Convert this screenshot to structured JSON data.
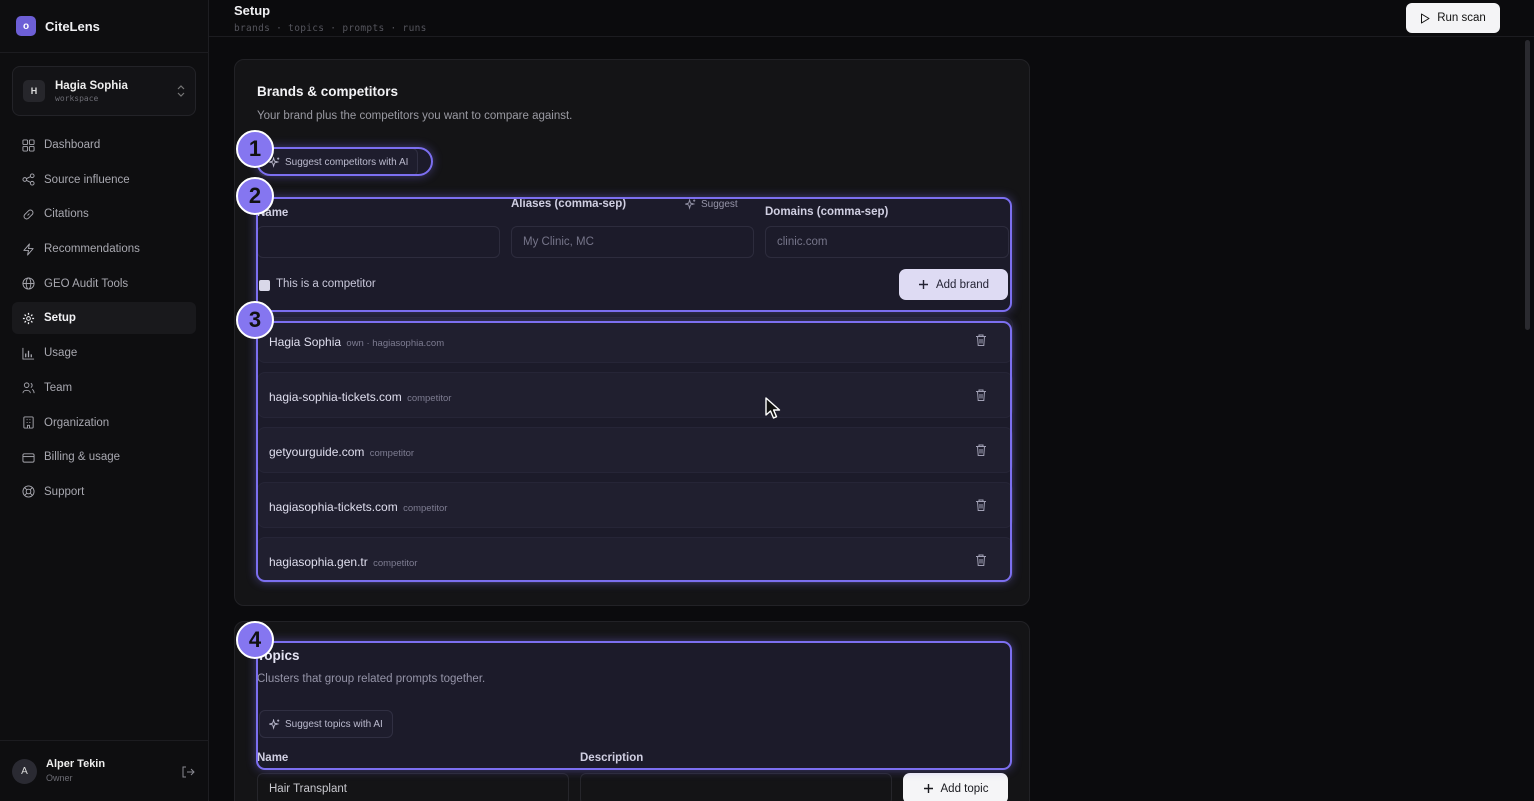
{
  "app": {
    "name": "CiteLens",
    "logo_letter": "o"
  },
  "workspace": {
    "avatar": "H",
    "name": "Hagia Sophia",
    "label": "workspace"
  },
  "sidebar": {
    "items": [
      {
        "label": "Dashboard",
        "icon": "grid-icon"
      },
      {
        "label": "Source influence",
        "icon": "share-icon"
      },
      {
        "label": "Citations",
        "icon": "link-icon"
      },
      {
        "label": "Recommendations",
        "icon": "bolt-icon"
      },
      {
        "label": "GEO Audit Tools",
        "icon": "globe-icon"
      },
      {
        "label": "Setup",
        "icon": "gear-icon",
        "active": true
      },
      {
        "label": "Usage",
        "icon": "bar-chart-icon"
      },
      {
        "label": "Team",
        "icon": "users-icon"
      },
      {
        "label": "Organization",
        "icon": "building-icon"
      },
      {
        "label": "Billing & usage",
        "icon": "card-icon"
      },
      {
        "label": "Support",
        "icon": "lifebuoy-icon"
      }
    ]
  },
  "user": {
    "avatar": "A",
    "name": "Alper Tekin",
    "role": "Owner"
  },
  "header": {
    "title": "Setup",
    "breadcrumb": "brands · topics · prompts · runs",
    "run_button": "Run scan"
  },
  "brands_card": {
    "title": "Brands & competitors",
    "description": "Your brand plus the competitors you want to compare against.",
    "suggest_button": "Suggest competitors with AI",
    "name_label": "Name",
    "aliases_label": "Aliases (comma-sep)",
    "aliases_suggest": "Suggest",
    "aliases_placeholder": "My Clinic, MC",
    "domains_label": "Domains (comma-sep)",
    "domains_placeholder": "clinic.com",
    "competitor_checkbox": "This is a competitor",
    "add_button": "Add brand",
    "rows": [
      {
        "name": "Hagia Sophia",
        "meta": "own · hagiasophia.com"
      },
      {
        "name": "hagia-sophia-tickets.com",
        "meta": "competitor"
      },
      {
        "name": "getyourguide.com",
        "meta": "competitor"
      },
      {
        "name": "hagiasophia-tickets.com",
        "meta": "competitor"
      },
      {
        "name": "hagiasophia.gen.tr",
        "meta": "competitor"
      }
    ]
  },
  "topics_card": {
    "title": "Topics",
    "description": "Clusters that group related prompts together.",
    "suggest_button": "Suggest topics with AI",
    "name_label": "Name",
    "description_label": "Description",
    "name_value": "Hair Transplant",
    "add_button": "Add topic"
  },
  "annotations": [
    "1",
    "2",
    "3",
    "4"
  ],
  "colors": {
    "accent": "#7c6ff0",
    "badge": "#8576f0",
    "background": "#0b0b0d"
  }
}
